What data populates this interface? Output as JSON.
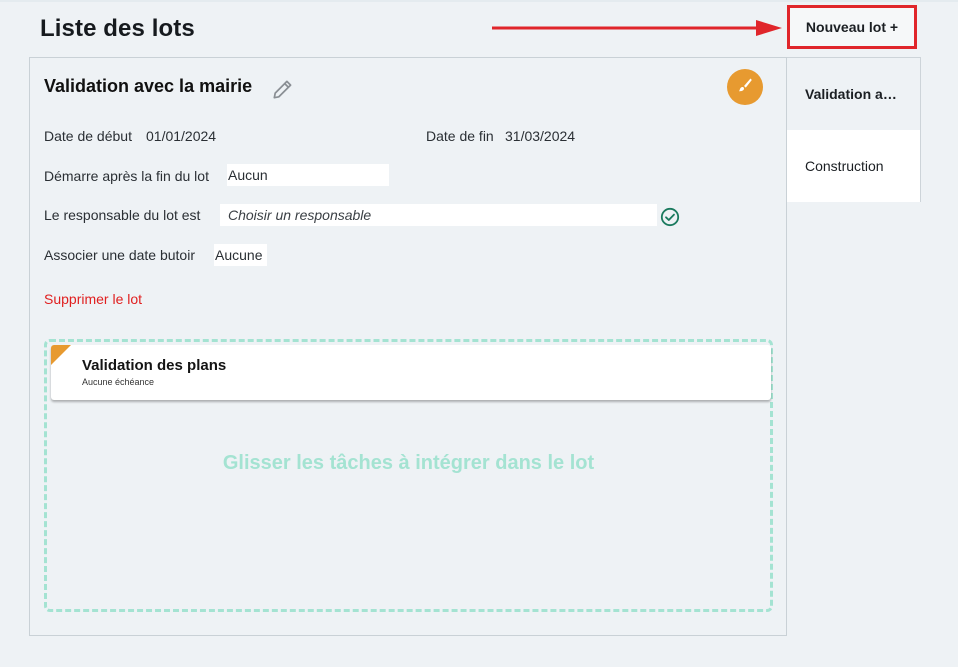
{
  "header": {
    "title": "Liste des lots",
    "new_lot_button": "Nouveau lot +"
  },
  "lot": {
    "title": "Validation avec la mairie",
    "start_label": "Date de début",
    "start_value": "01/01/2024",
    "end_label": "Date de fin",
    "end_value": "31/03/2024",
    "depends_label": "Démarre après la fin du lot",
    "depends_value": "Aucun",
    "owner_label": "Le responsable du lot est",
    "owner_placeholder": "Choisir un responsable",
    "deadline_label": "Associer une date butoir",
    "deadline_value": "Aucune",
    "delete_label": "Supprimer le lot"
  },
  "tasks": [
    {
      "title": "Validation des plans",
      "subtitle": "Aucune échéance"
    }
  ],
  "dropzone": {
    "hint": "Glisser les tâches à intégrer dans le lot"
  },
  "lot_list": [
    {
      "label": "Validation avec la mairie",
      "active": true
    },
    {
      "label": "Construction",
      "active": false
    }
  ],
  "colors": {
    "accent_orange": "#e79a30",
    "danger_red": "#e01f1f",
    "dropzone_mint": "#a4e3d2",
    "check_green": "#1a7a5e",
    "annotation_red": "#e0262b"
  },
  "icons": {
    "edit": "pencil-icon",
    "brush": "paintbrush-icon",
    "check": "check-circle-icon"
  }
}
